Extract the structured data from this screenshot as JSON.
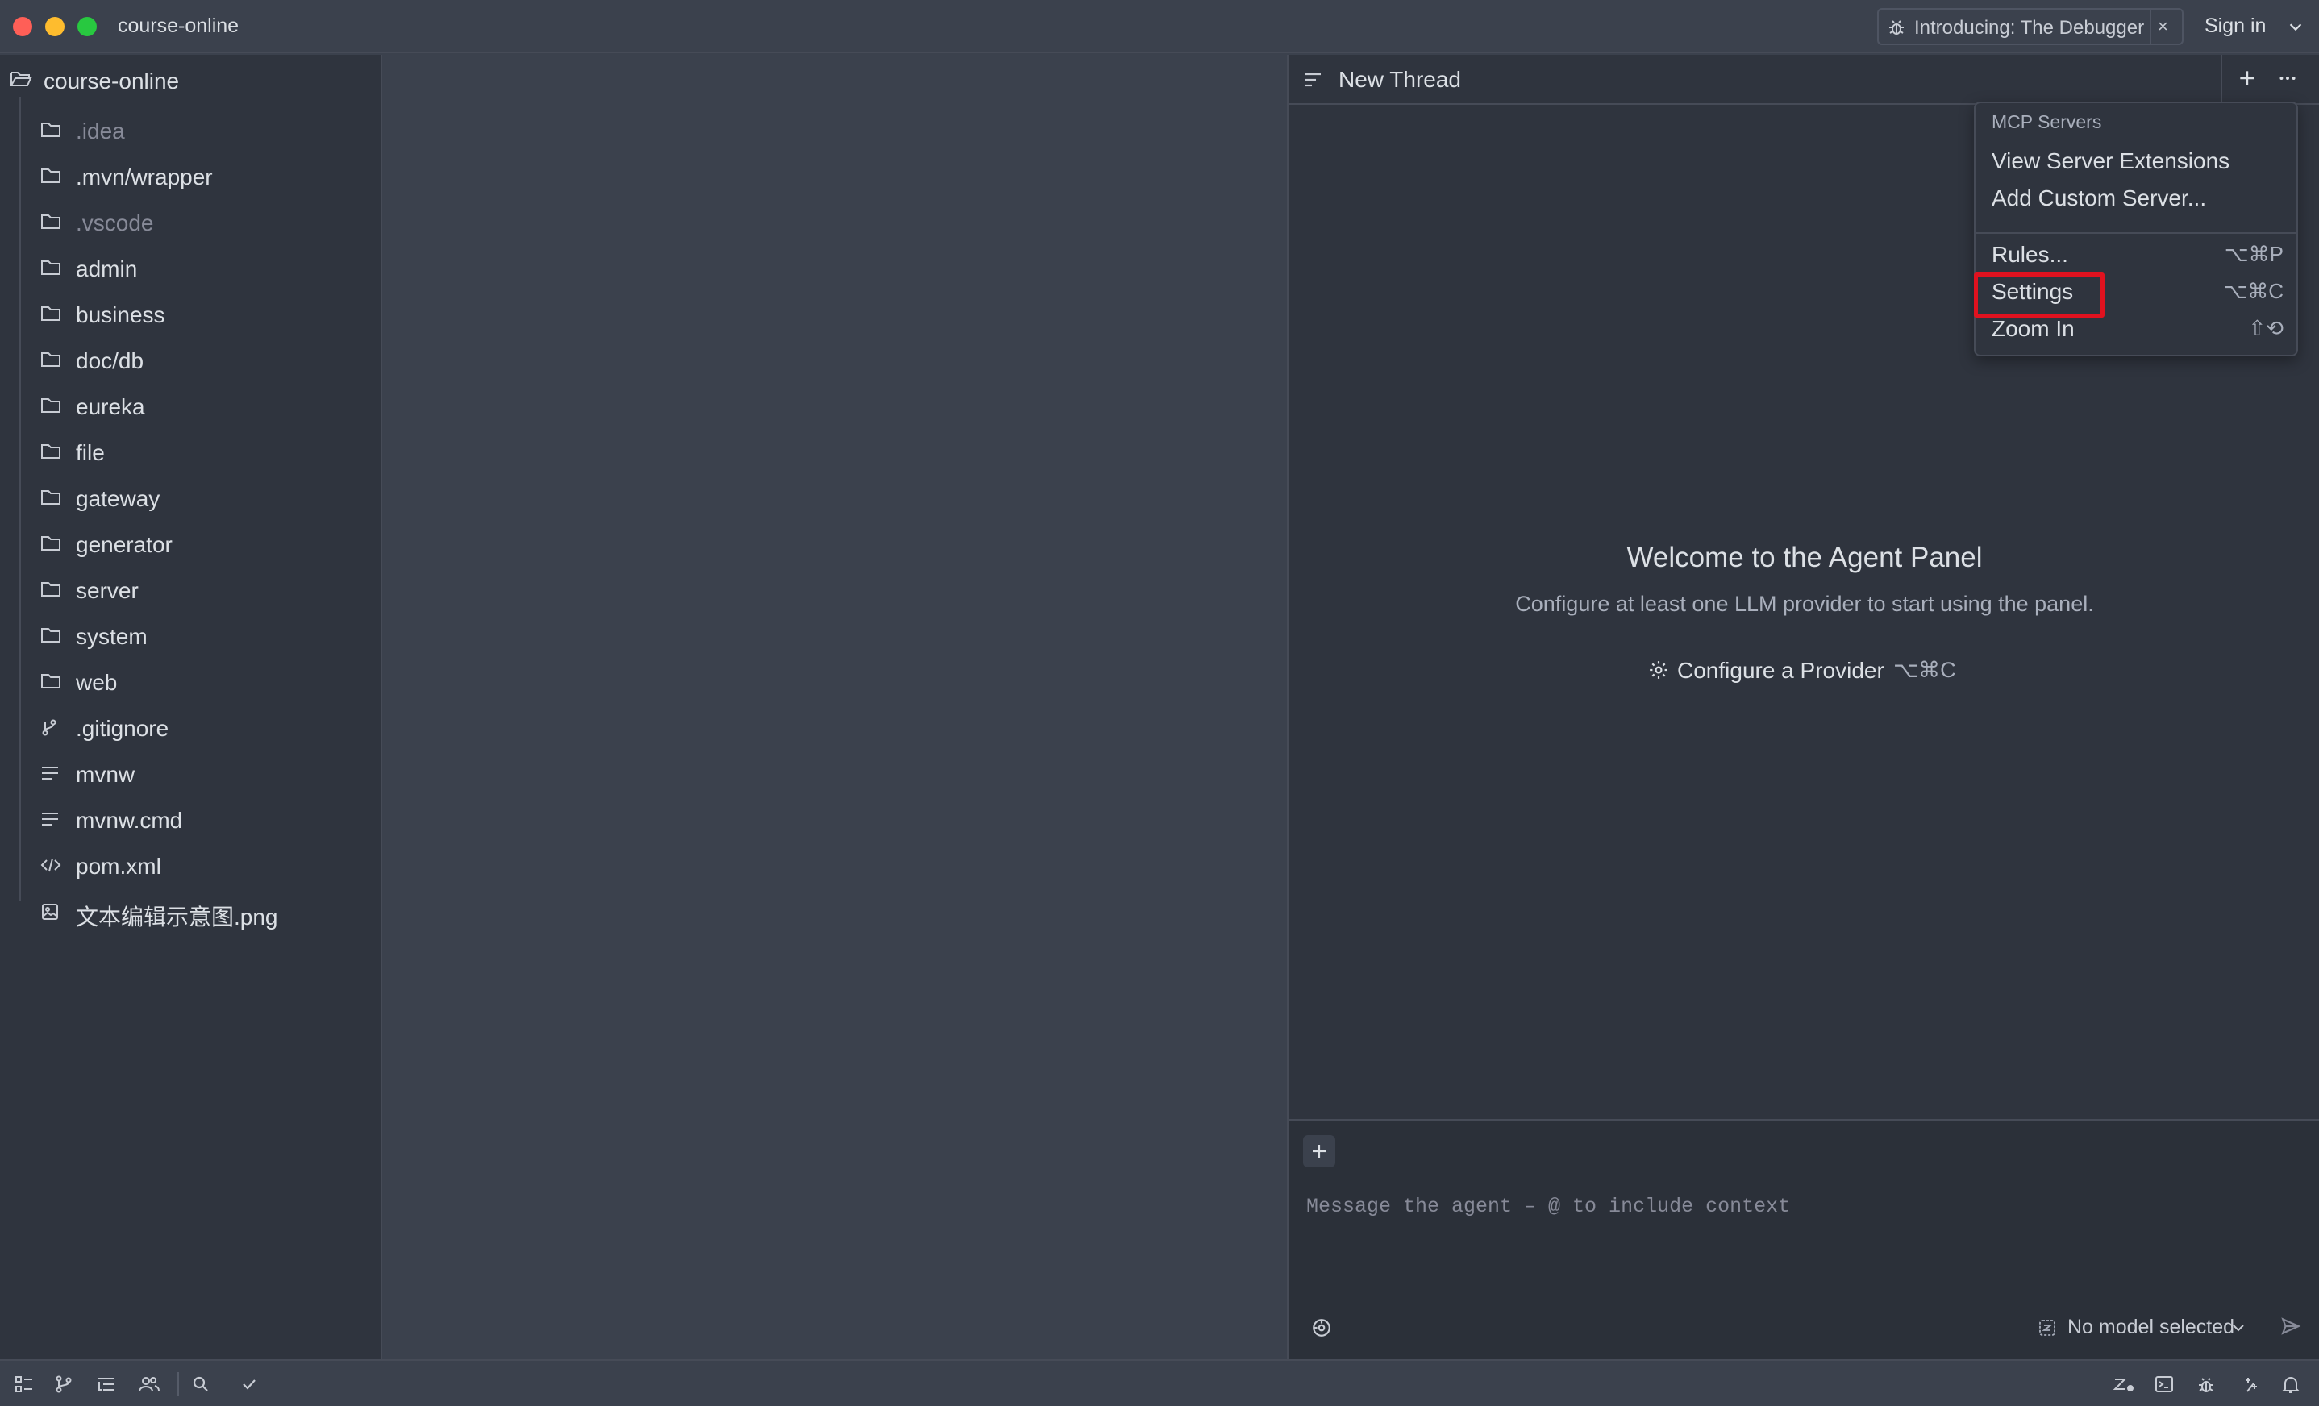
{
  "window": {
    "project_title": "course-online",
    "announcement": "Introducing: The Debugger",
    "announcement_close": "×",
    "sign_in": "Sign in"
  },
  "project_panel": {
    "root": "course-online",
    "items": [
      {
        "label": ".idea",
        "icon": "folder-icon",
        "dim": true
      },
      {
        "label": ".mvn/wrapper",
        "icon": "folder-icon",
        "dim": false
      },
      {
        "label": ".vscode",
        "icon": "folder-icon",
        "dim": true
      },
      {
        "label": "admin",
        "icon": "folder-icon",
        "dim": false
      },
      {
        "label": "business",
        "icon": "folder-icon",
        "dim": false
      },
      {
        "label": "doc/db",
        "icon": "folder-icon",
        "dim": false
      },
      {
        "label": "eureka",
        "icon": "folder-icon",
        "dim": false
      },
      {
        "label": "file",
        "icon": "folder-icon",
        "dim": false
      },
      {
        "label": "gateway",
        "icon": "folder-icon",
        "dim": false
      },
      {
        "label": "generator",
        "icon": "folder-icon",
        "dim": false
      },
      {
        "label": "server",
        "icon": "folder-icon",
        "dim": false
      },
      {
        "label": "system",
        "icon": "folder-icon",
        "dim": false
      },
      {
        "label": "web",
        "icon": "folder-icon",
        "dim": false
      },
      {
        "label": ".gitignore",
        "icon": "git-branch-icon",
        "dim": false
      },
      {
        "label": "mvnw",
        "icon": "text-file-icon",
        "dim": false
      },
      {
        "label": "mvnw.cmd",
        "icon": "text-file-icon",
        "dim": false
      },
      {
        "label": "pom.xml",
        "icon": "code-file-icon",
        "dim": false
      },
      {
        "label": "文本编辑示意图.png",
        "icon": "image-file-icon",
        "dim": false
      }
    ]
  },
  "agent_panel": {
    "thread_title": "New Thread",
    "welcome_title": "Welcome to the Agent Panel",
    "welcome_subtitle": "Configure at least one LLM provider to start using the panel.",
    "configure_label": "Configure a Provider",
    "configure_shortcut": "⌥⌘C",
    "message_placeholder": "Message the agent – @ to include context",
    "model_label": "No model selected"
  },
  "menu": {
    "header": "MCP Servers",
    "items": [
      {
        "label": "View Server Extensions",
        "shortcut": ""
      },
      {
        "label": "Add Custom Server...",
        "shortcut": ""
      },
      {
        "label": "Rules...",
        "shortcut": "⌥⌘P"
      },
      {
        "label": "Settings",
        "shortcut": "⌥⌘C",
        "highlighted": true
      },
      {
        "label": "Zoom In",
        "shortcut": "⇧⟲"
      }
    ]
  },
  "colors": {
    "highlight_border": "#e0121f",
    "panel_bg": "#2f343e",
    "editor_bg": "#3b414d"
  }
}
